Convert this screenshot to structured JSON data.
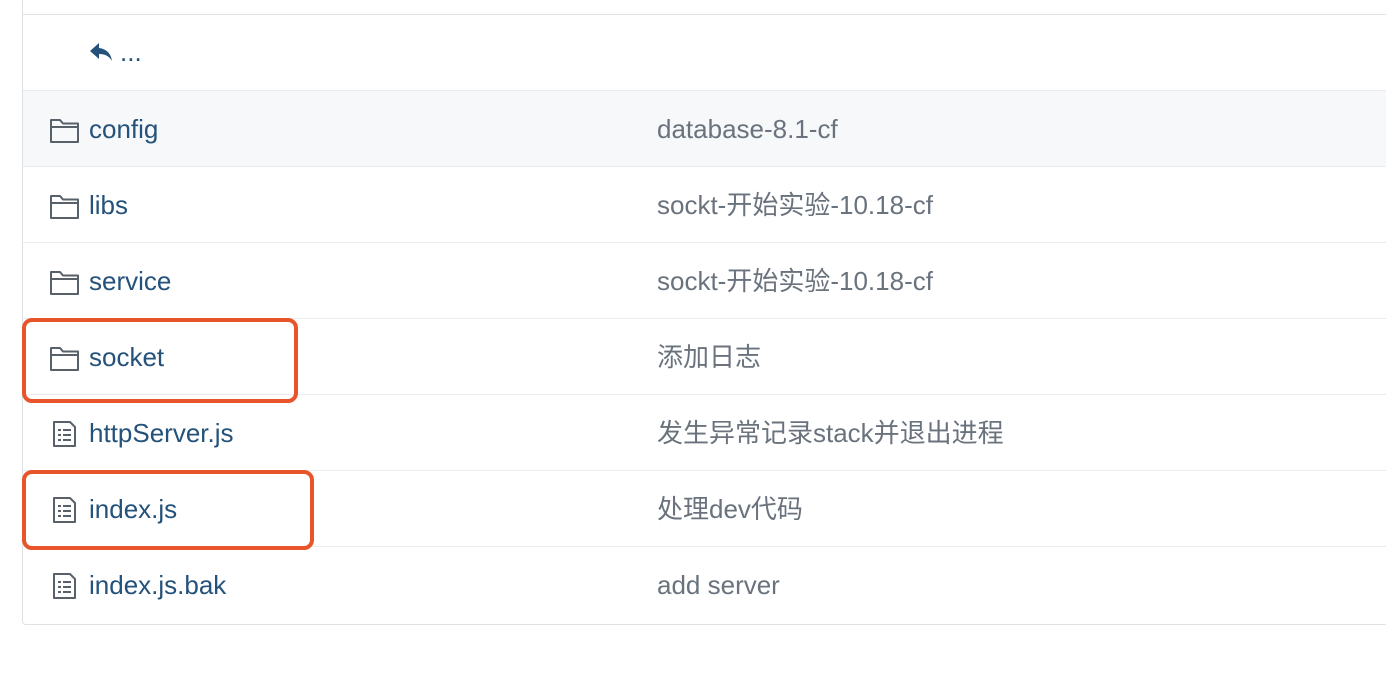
{
  "navigation": {
    "up_label": "..."
  },
  "files": [
    {
      "type": "folder",
      "name": "config",
      "message": "database-8.1-cf"
    },
    {
      "type": "folder",
      "name": "libs",
      "message": "sockt-开始实验-10.18-cf"
    },
    {
      "type": "folder",
      "name": "service",
      "message": "sockt-开始实验-10.18-cf"
    },
    {
      "type": "folder",
      "name": "socket",
      "message": "添加日志"
    },
    {
      "type": "file",
      "name": "httpServer.js",
      "message": "发生异常记录stack并退出进程"
    },
    {
      "type": "file",
      "name": "index.js",
      "message": "处理dev代码"
    },
    {
      "type": "file",
      "name": "index.js.bak",
      "message": "add server"
    }
  ],
  "icons": {
    "folder": "folder-icon",
    "file": "file-text-icon",
    "up": "reply-arrow-icon"
  },
  "colors": {
    "link": "#24527a",
    "message": "#6a737d",
    "highlight": "#e8552a",
    "hover_row": "#f6f8fa"
  }
}
